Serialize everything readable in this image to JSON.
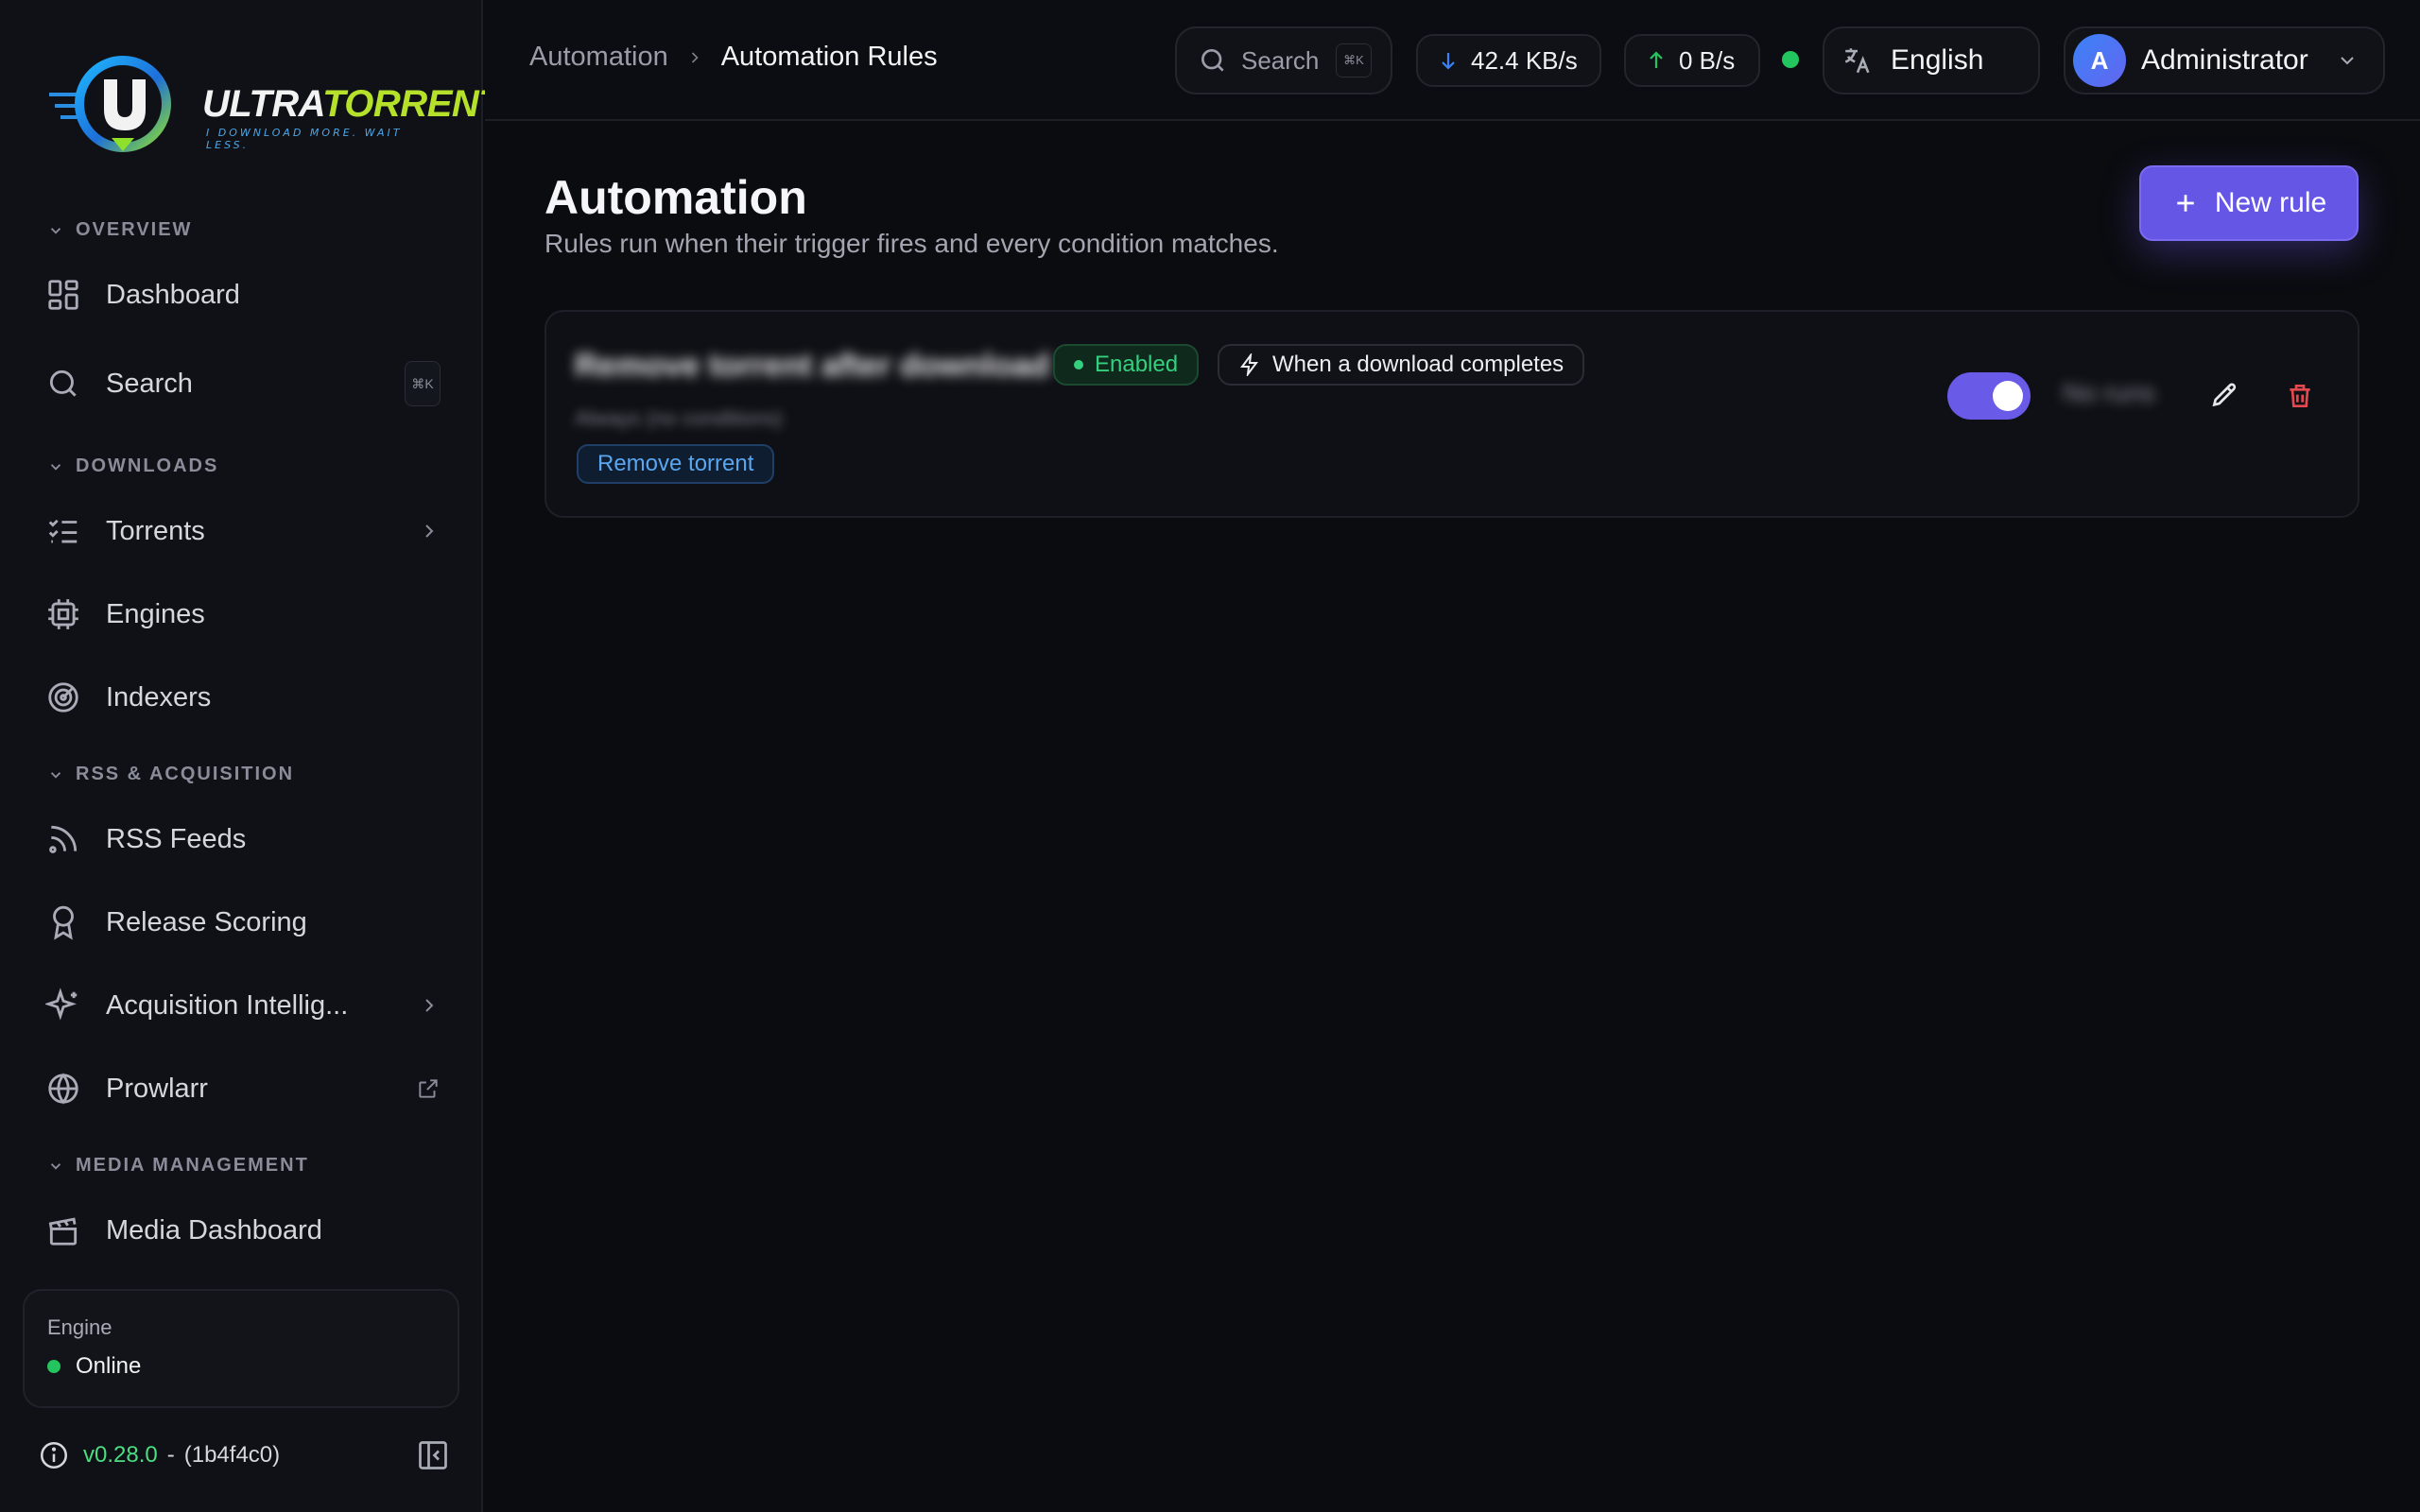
{
  "app": {
    "logo_word_1": "ULTRA",
    "logo_word_2": "TORRENT",
    "logo_tagline": "I DOWNLOAD MORE. WAIT LESS."
  },
  "sidebar": {
    "sections": {
      "overview": "OVERVIEW",
      "downloads": "DOWNLOADS",
      "rss": "RSS & ACQUISITION",
      "media": "MEDIA MANAGEMENT"
    },
    "items": {
      "dashboard": "Dashboard",
      "search": "Search",
      "search_shortcut": "⌘K",
      "torrents": "Torrents",
      "engines": "Engines",
      "indexers": "Indexers",
      "rss_feeds": "RSS Feeds",
      "release_scoring": "Release Scoring",
      "acquisition": "Acquisition Intellig...",
      "prowlarr": "Prowlarr",
      "media_dashboard": "Media Dashboard"
    },
    "engine": {
      "label": "Engine",
      "status": "Online",
      "status_color": "#22c55e"
    },
    "version": {
      "number": "v0.28.0",
      "separator": "-",
      "commit": "(1b4f4c0)"
    }
  },
  "topbar": {
    "breadcrumb": {
      "parent": "Automation",
      "current": "Automation Rules"
    },
    "search": {
      "label": "Search",
      "shortcut": "⌘K"
    },
    "download_speed": "42.4 KB/s",
    "upload_speed": "0 B/s",
    "language": "English",
    "user": {
      "initial": "A",
      "name": "Administrator"
    }
  },
  "main": {
    "title": "Automation",
    "subtitle": "Rules run when their trigger fires and every condition matches.",
    "new_rule_label": "New rule",
    "accent_color": "#6656e6",
    "rules": [
      {
        "name": "Remove torrent after download",
        "description": "Always (no conditions)",
        "status": "Enabled",
        "trigger": "When a download completes",
        "action": "Remove torrent",
        "enabled": true,
        "runs": "No runs"
      }
    ]
  }
}
